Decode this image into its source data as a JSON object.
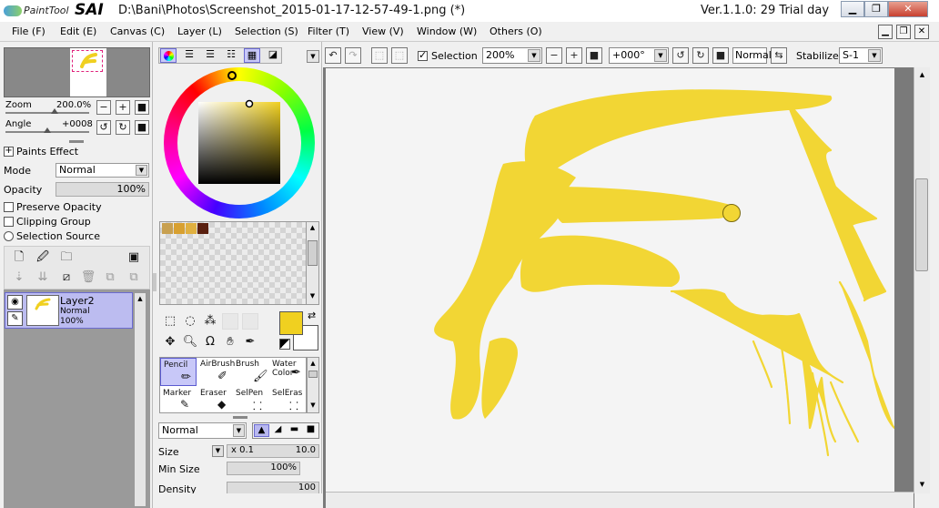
{
  "app": {
    "logo_text_1": "PaintTool",
    "logo_text_2": "SAI",
    "title": "D:\\Bani\\Photos\\Screenshot_2015-01-17-12-57-49-1.png (*)",
    "version": "Ver.1.1.0: 29 Trial day"
  },
  "menubar": {
    "items": [
      "File (F)",
      "Edit (E)",
      "Canvas (C)",
      "Layer (L)",
      "Selection (S)",
      "Filter (T)",
      "View (V)",
      "Window (W)",
      "Others (O)"
    ]
  },
  "navigator": {
    "zoom_label": "Zoom",
    "zoom_value": "200.0%",
    "angle_label": "Angle",
    "angle_value": "+0008"
  },
  "layer_props": {
    "paints_effect": "Paints Effect",
    "mode_label": "Mode",
    "mode_value": "Normal",
    "opacity_label": "Opacity",
    "opacity_value": "100%",
    "preserve_opacity": "Preserve Opacity",
    "clipping_group": "Clipping Group",
    "selection_source": "Selection Source"
  },
  "layers": [
    {
      "name": "Layer2",
      "mode": "Normal",
      "opacity": "100%"
    }
  ],
  "colors": {
    "foreground": "#f0d020",
    "background": "#ffffff",
    "swatches": [
      "#c8a050",
      "#d8a030",
      "#e0b040",
      "#5a2010"
    ]
  },
  "tools": [
    {
      "label": "Pencil",
      "icon": "pencil-icon",
      "selected": true
    },
    {
      "label": "AirBrush",
      "icon": "airbrush-icon",
      "selected": false
    },
    {
      "label": "Brush",
      "icon": "brush-icon",
      "selected": false
    },
    {
      "label": "Water Color",
      "icon": "watercolor-icon",
      "selected": false
    },
    {
      "label": "Marker",
      "icon": "marker-icon",
      "selected": false
    },
    {
      "label": "Eraser",
      "icon": "eraser-icon",
      "selected": false
    },
    {
      "label": "SelPen",
      "icon": "selpen-icon",
      "selected": false
    },
    {
      "label": "SelEras",
      "icon": "seleras-icon",
      "selected": false
    }
  ],
  "brush": {
    "blend_mode": "Normal",
    "size_label": "Size",
    "size_mult": "x 0.1",
    "size_value": "10.0",
    "min_size_label": "Min Size",
    "min_size_value": "100%",
    "density_label": "Density",
    "density_value": "100"
  },
  "canvas_toolbar": {
    "selection_label": "Selection",
    "selection_checked": true,
    "zoom_value": "200%",
    "angle_value": "+000°",
    "blend_value": "Normal",
    "stabilizer_label": "Stabilizer",
    "stabilizer_value": "S-1"
  },
  "paint_color": "#f2d634"
}
